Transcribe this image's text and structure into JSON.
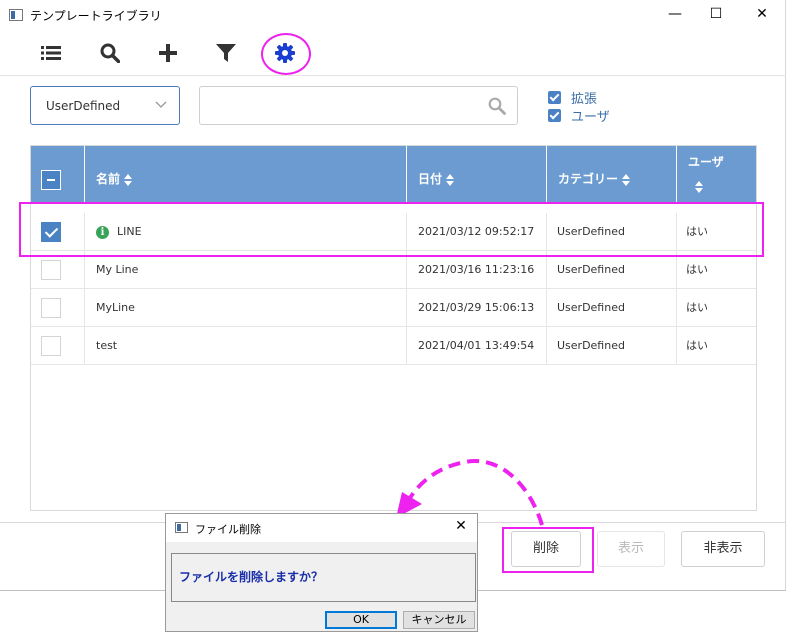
{
  "window": {
    "title": "テンプレートライブラリ",
    "minimize": "—",
    "maximize": "☐",
    "close": "✕"
  },
  "toolbar": {
    "items": [
      "list-icon",
      "search-icon",
      "add-icon",
      "filter-icon",
      "gear-icon"
    ],
    "highlight_color": "#ee22ee"
  },
  "filters": {
    "category_value": "UserDefined",
    "search_value": "",
    "checkboxes": [
      {
        "label": "拡張",
        "checked": true
      },
      {
        "label": "ユーザ",
        "checked": true
      }
    ]
  },
  "table": {
    "columns": [
      "名前",
      "日付",
      "カテゴリー",
      "ユーザ"
    ],
    "rows": [
      {
        "checked": true,
        "info": true,
        "name": "LINE",
        "date": "2021/03/12 09:52:17",
        "category": "UserDefined",
        "user": "はい"
      },
      {
        "checked": false,
        "info": false,
        "name": "My Line",
        "date": "2021/03/16 11:23:16",
        "category": "UserDefined",
        "user": "はい"
      },
      {
        "checked": false,
        "info": false,
        "name": "MyLine",
        "date": "2021/03/29 15:06:13",
        "category": "UserDefined",
        "user": "はい"
      },
      {
        "checked": false,
        "info": false,
        "name": "test",
        "date": "2021/04/01 13:49:54",
        "category": "UserDefined",
        "user": "はい"
      }
    ],
    "header_color": "#6b9bd0"
  },
  "buttons": {
    "delete": "削除",
    "show": "表示",
    "hide": "非表示"
  },
  "dialog": {
    "title": "ファイル削除",
    "close": "✕",
    "message": "ファイルを削除しますか？",
    "ok": "OK",
    "cancel": "キャンセル"
  }
}
